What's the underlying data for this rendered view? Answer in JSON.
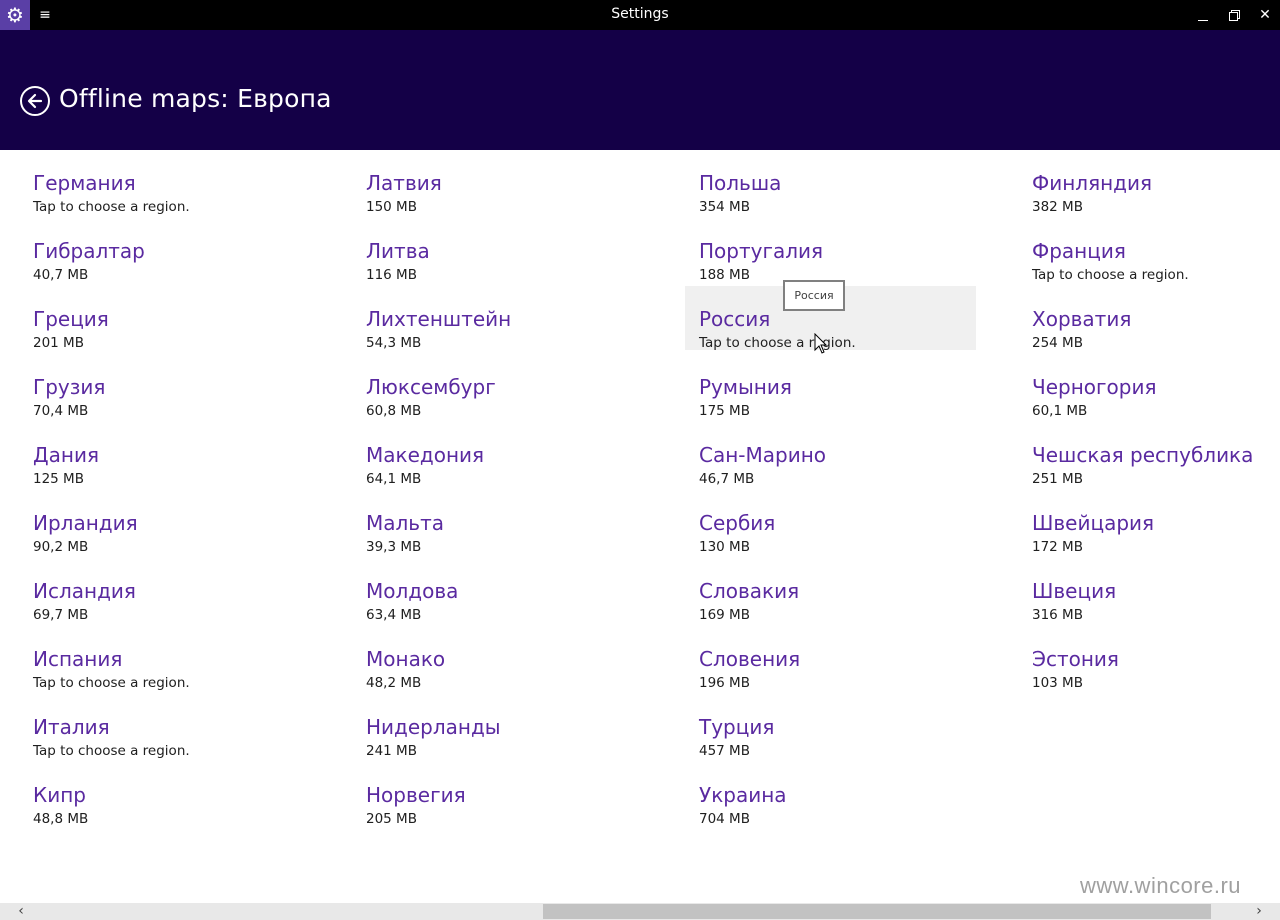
{
  "window": {
    "title": "Settings",
    "app_icon": "gear-icon",
    "menu_icon": "hamburger-icon",
    "minimize_icon": "minimize-icon",
    "maximize_icon": "restore-icon",
    "close_icon": "close-icon",
    "close_glyph": "✕"
  },
  "header": {
    "back_icon": "back-arrow-icon",
    "title": "Offline maps: Европа",
    "background": "#140047"
  },
  "accent_color": "#5a2aa0",
  "columns": [
    [
      {
        "name": "Германия",
        "size": "Tap to choose a region."
      },
      {
        "name": "Гибралтар",
        "size": "40,7 MB"
      },
      {
        "name": "Греция",
        "size": "201 MB"
      },
      {
        "name": "Грузия",
        "size": "70,4 MB"
      },
      {
        "name": "Дания",
        "size": "125 MB"
      },
      {
        "name": "Ирландия",
        "size": "90,2 MB"
      },
      {
        "name": "Исландия",
        "size": "69,7 MB"
      },
      {
        "name": "Испания",
        "size": "Tap to choose a region."
      },
      {
        "name": "Италия",
        "size": "Tap to choose a region."
      },
      {
        "name": "Кипр",
        "size": "48,8 MB"
      }
    ],
    [
      {
        "name": "Латвия",
        "size": "150 MB"
      },
      {
        "name": "Литва",
        "size": "116 MB"
      },
      {
        "name": "Лихтенштейн",
        "size": "54,3 MB"
      },
      {
        "name": "Люксембург",
        "size": "60,8 MB"
      },
      {
        "name": "Македония",
        "size": "64,1 MB"
      },
      {
        "name": "Мальта",
        "size": "39,3 MB"
      },
      {
        "name": "Молдова",
        "size": "63,4 MB"
      },
      {
        "name": "Монако",
        "size": "48,2 MB"
      },
      {
        "name": "Нидерланды",
        "size": "241 MB"
      },
      {
        "name": "Норвегия",
        "size": "205 MB"
      }
    ],
    [
      {
        "name": "Польша",
        "size": "354 MB"
      },
      {
        "name": "Португалия",
        "size": "188 MB"
      },
      {
        "name": "Россия",
        "size": "Tap to choose a region.",
        "hovered": true
      },
      {
        "name": "Румыния",
        "size": "175 MB"
      },
      {
        "name": "Сан-Марино",
        "size": "46,7 MB"
      },
      {
        "name": "Сербия",
        "size": "130 MB"
      },
      {
        "name": "Словакия",
        "size": "169 MB"
      },
      {
        "name": "Словения",
        "size": "196 MB"
      },
      {
        "name": "Турция",
        "size": "457 MB"
      },
      {
        "name": "Украина",
        "size": "704 MB"
      }
    ],
    [
      {
        "name": "Финляндия",
        "size": "382 MB"
      },
      {
        "name": "Франция",
        "size": "Tap to choose a region."
      },
      {
        "name": "Хорватия",
        "size": "254 MB"
      },
      {
        "name": "Черногория",
        "size": "60,1 MB"
      },
      {
        "name": "Чешская республика",
        "size": "251 MB"
      },
      {
        "name": "Швейцария",
        "size": "172 MB"
      },
      {
        "name": "Швеция",
        "size": "316 MB"
      },
      {
        "name": "Эстония",
        "size": "103 MB"
      }
    ]
  ],
  "tooltip": {
    "text": "Россия"
  },
  "watermark": {
    "text": "www.wincore.ru"
  },
  "scrollbar": {
    "left_icon": "chevron-left-icon",
    "right_icon": "chevron-right-icon",
    "left_glyph": "‹",
    "right_glyph": "›"
  }
}
